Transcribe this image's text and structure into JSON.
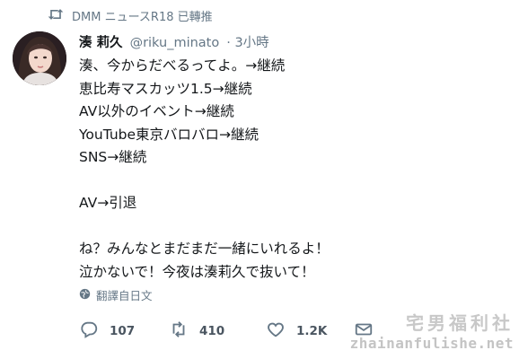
{
  "retweet_context": {
    "text": "DMM ニュースR18 已轉推",
    "icon": "retweet-icon"
  },
  "author": {
    "display_name": "湊 莉久",
    "handle": "@riku_minato",
    "time": "· 3小時"
  },
  "body_lines": [
    "湊、今からだべるってよ。→継続",
    "恵比寿マスカッツ1.5→継続",
    "AV以外のイベント→継続",
    "YouTube東京バロバロ→継続",
    "SNS→継続",
    "",
    "AV→引退",
    "",
    "ね？みんなとまだまだ一緒にいれるよ！",
    "泣かないで！今夜は湊莉久で抜いて！"
  ],
  "translate": {
    "label": "翻譯自日文",
    "icon": "globe-icon"
  },
  "actions": {
    "reply_count": "107",
    "retweet_count": "410",
    "like_count": "1.2K",
    "icons": [
      "reply-icon",
      "retweet-icon",
      "heart-icon",
      "mail-icon"
    ]
  },
  "watermark": {
    "line1": "宅男福利社",
    "line2": "zhainanfulishe.net"
  },
  "colors": {
    "secondary_text": "#657786",
    "primary_text": "#14171a",
    "action_icon": "#657786"
  }
}
